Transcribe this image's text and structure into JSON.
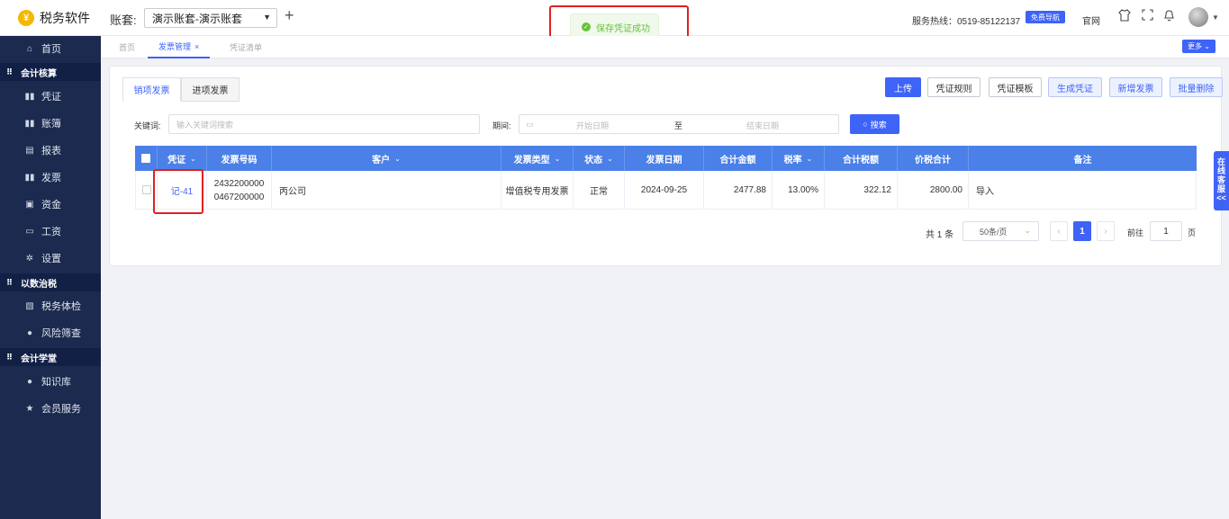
{
  "app": {
    "name": "税务软件",
    "logo_glyph": "¥"
  },
  "header": {
    "account_label": "账套:",
    "account_value": "演示账套-演示账套",
    "add_glyph": "+",
    "hotline": "服务热线：0519-85122137",
    "free_nav": "免费导航",
    "home_link": "官网",
    "icons": [
      "shirt-icon",
      "fullscreen-icon",
      "bell-icon"
    ]
  },
  "toast": {
    "message": "保存凭证成功",
    "ok_glyph": "✓"
  },
  "sidebar": {
    "items": [
      {
        "label": "首页",
        "icon": "home-icon",
        "glyph": "⌂"
      },
      {
        "group": "会计核算"
      },
      {
        "label": "凭证",
        "icon": "voucher-icon",
        "glyph": "▮▮"
      },
      {
        "label": "账簿",
        "icon": "ledger-icon",
        "glyph": "▮▮"
      },
      {
        "label": "报表",
        "icon": "report-icon",
        "glyph": "▤"
      },
      {
        "label": "发票",
        "icon": "invoice-icon",
        "glyph": "▮▮"
      },
      {
        "label": "资金",
        "icon": "fund-icon",
        "glyph": "▣"
      },
      {
        "label": "工资",
        "icon": "salary-icon",
        "glyph": "▭"
      },
      {
        "label": "设置",
        "icon": "gear-icon",
        "glyph": "✲"
      },
      {
        "group": "以数治税"
      },
      {
        "label": "税务体检",
        "icon": "checkup-icon",
        "glyph": "▧"
      },
      {
        "label": "风险筛查",
        "icon": "risk-icon",
        "glyph": "●"
      },
      {
        "group": "会计学堂"
      },
      {
        "label": "知识库",
        "icon": "pin-icon",
        "glyph": "●"
      },
      {
        "label": "会员服务",
        "icon": "star-icon",
        "glyph": "★"
      }
    ],
    "group_glyph": "⠿"
  },
  "tabs": [
    {
      "label": "首页"
    },
    {
      "label": "发票管理",
      "close": "×"
    },
    {
      "label": "凭证清单"
    }
  ],
  "more_button": "更多 ⌄",
  "subtabs": [
    "销项发票",
    "进项发票"
  ],
  "toolbar": [
    "上传",
    "凭证规则",
    "凭证模板",
    "生成凭证",
    "新增发票",
    "批量删除"
  ],
  "filters": {
    "keyword_label": "关键词:",
    "keyword_placeholder": "输入关键词搜索",
    "period_label": "期间:",
    "start_placeholder": "开始日期",
    "separator": "至",
    "end_placeholder": "结束日期",
    "search_button": "搜索",
    "calendar_glyph": "▭",
    "search_glyph": "○"
  },
  "table": {
    "columns": [
      "凭证",
      "发票号码",
      "客户",
      "发票类型",
      "状态",
      "发票日期",
      "合计金额",
      "税率",
      "合计税额",
      "价税合计",
      "备注"
    ],
    "dropdown_glyph": "⌄",
    "rows": [
      {
        "voucher": "记-41",
        "invoice_no_1": "2432200000",
        "invoice_no_2": "0467200000",
        "customer": "丙公司",
        "invoice_type": "增值税专用发票",
        "status": "正常",
        "date": "2024-09-25",
        "amount": "2477.88",
        "tax_rate": "13.00%",
        "tax_amount": "322.12",
        "total": "2800.00",
        "remark": "导入"
      }
    ]
  },
  "pagination": {
    "total": "共 1 条",
    "page_size": "50条/页",
    "prev": "‹",
    "current": "1",
    "next": "›",
    "goto_label": "前往",
    "goto_value": "1",
    "page_suffix": "页",
    "caret": "⌄"
  },
  "service_tab": [
    "在",
    "线",
    "客",
    "服",
    "<<"
  ],
  "colors": {
    "primary": "#3e63f7",
    "sidebar": "#1b2a4e",
    "highlight": "#e02020",
    "success": "#67c23a"
  }
}
